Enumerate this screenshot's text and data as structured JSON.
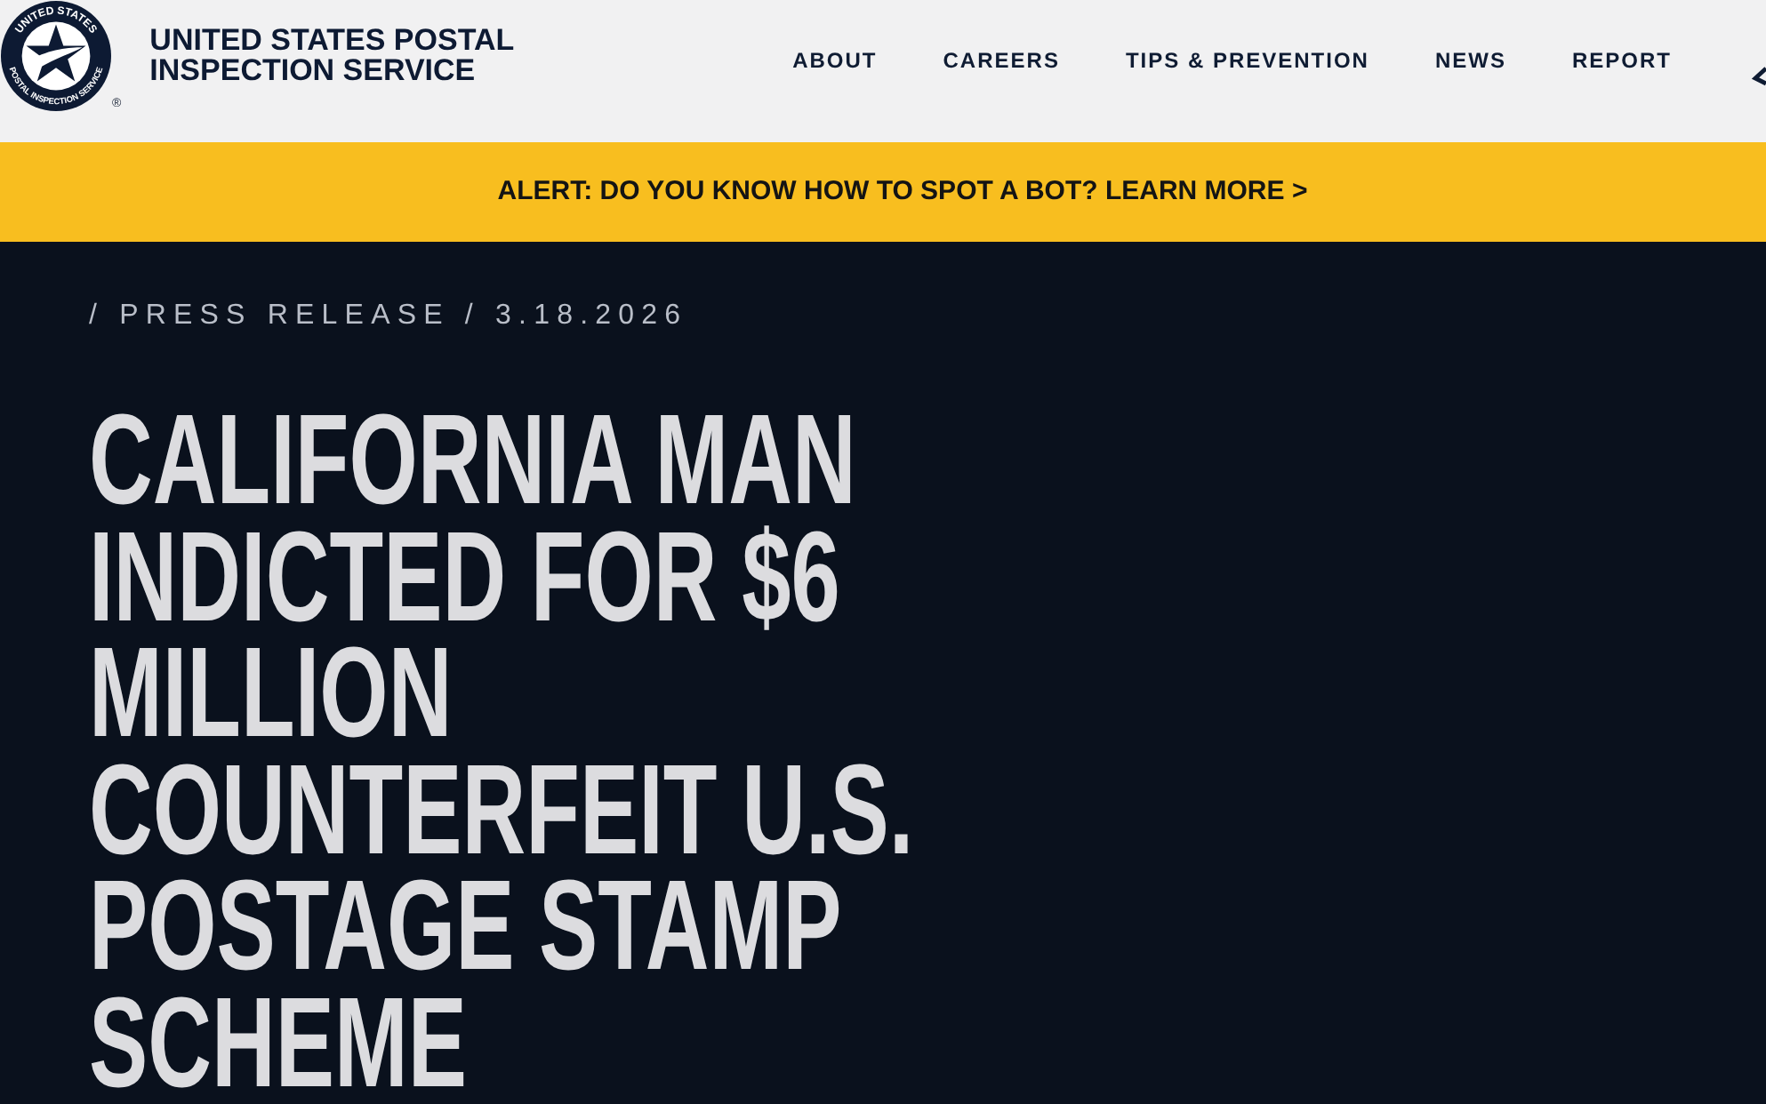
{
  "header": {
    "logo": {
      "seal_top": "UNITED STATES",
      "seal_bottom": "POSTAL INSPECTION SERVICE",
      "registered_mark": "®"
    },
    "title": "UNITED STATES POSTAL INSPECTION SERVICE",
    "nav": [
      "ABOUT",
      "CAREERS",
      "TIPS & PREVENTION",
      "NEWS",
      "REPORT"
    ]
  },
  "alert": {
    "text": "ALERT: DO YOU KNOW HOW TO SPOT A BOT? LEARN MORE >"
  },
  "article": {
    "breadcrumb": "/ PRESS RELEASE / 3.18.2026",
    "headline": "CALIFORNIA MAN INDICTED FOR $6 MILLION COUNTERFEIT U.S. POSTAGE STAMP SCHEME"
  }
}
